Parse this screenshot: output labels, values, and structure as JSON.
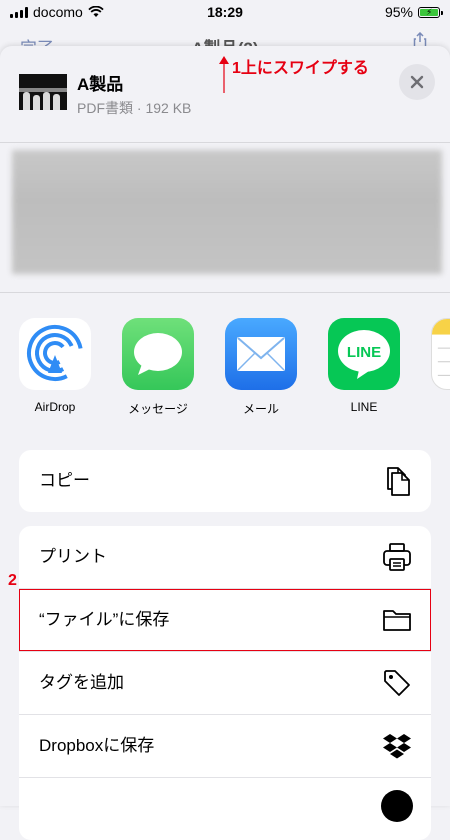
{
  "status": {
    "carrier": "docomo",
    "time": "18:29",
    "battery": "95%"
  },
  "behind": {
    "left": "完了",
    "title": "A製品(2)"
  },
  "document": {
    "title": "A製品",
    "subtitle": "PDF書類 · 192 KB"
  },
  "apps": [
    {
      "label": "AirDrop",
      "icon": "airdrop-icon",
      "color": "#2f8cf5"
    },
    {
      "label": "メッセージ",
      "icon": "messages-icon",
      "color": "#35c759"
    },
    {
      "label": "メール",
      "icon": "mail-icon",
      "color": "#1e88f0"
    },
    {
      "label": "LINE",
      "icon": "line-icon",
      "color": "#06c755"
    }
  ],
  "actions_group1": [
    {
      "label": "コピー",
      "icon": "copy-icon"
    }
  ],
  "actions_group2": [
    {
      "label": "プリント",
      "icon": "printer-icon"
    },
    {
      "label": "“ファイル”に保存",
      "icon": "folder-icon"
    },
    {
      "label": "タグを追加",
      "icon": "tag-icon"
    },
    {
      "label": "Dropboxに保存",
      "icon": "dropbox-icon"
    }
  ],
  "annotations": {
    "step1": "1上にスワイプする",
    "step2": "2",
    "color": "#e60012"
  }
}
